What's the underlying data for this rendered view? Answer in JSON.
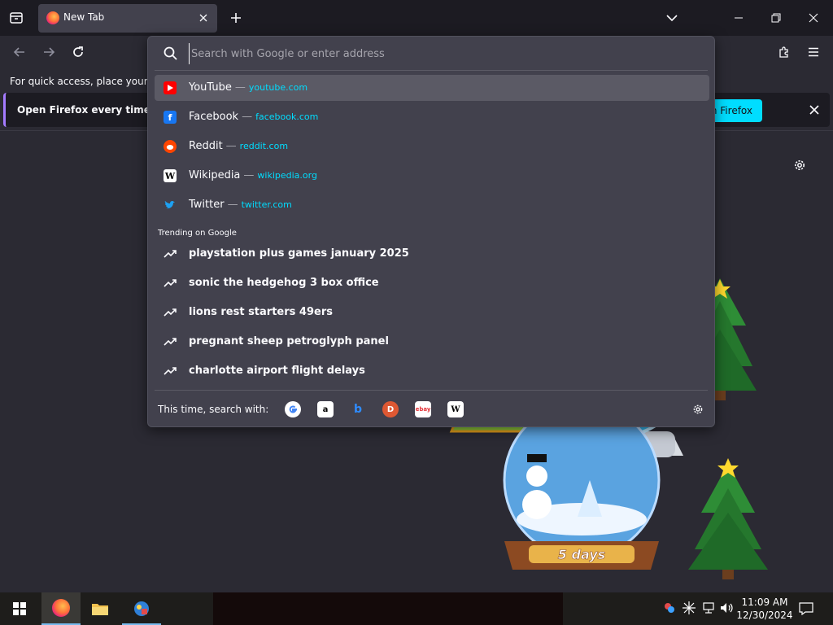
{
  "browser": {
    "tab": {
      "title": "New Tab"
    },
    "newtab_symbol": "+"
  },
  "content": {
    "bookmarks_hint": "For quick access, place your boo",
    "default_bar": {
      "message": "Open Firefox every time you",
      "cta": "n Firefox"
    }
  },
  "urlbar": {
    "placeholder": "Search with Google or enter address",
    "top_sites": [
      {
        "title": "YouTube",
        "url": "youtube.com",
        "icon": "youtube-icon",
        "color": "#ff0000"
      },
      {
        "title": "Facebook",
        "url": "facebook.com",
        "icon": "facebook-icon",
        "color": "#1877f2"
      },
      {
        "title": "Reddit",
        "url": "reddit.com",
        "icon": "reddit-icon",
        "color": "#ff4500"
      },
      {
        "title": "Wikipedia",
        "url": "wikipedia.org",
        "icon": "wikipedia-icon",
        "color": "#ffffff"
      },
      {
        "title": "Twitter",
        "url": "twitter.com",
        "icon": "twitter-icon",
        "color": "#1da1f2"
      }
    ],
    "dash": "—",
    "trending_label": "Trending on Google",
    "trending": [
      "playstation plus games january 2025",
      "sonic the hedgehog 3 box office",
      "lions rest starters 49ers",
      "pregnant sheep petroglyph panel",
      "charlotte airport flight delays"
    ],
    "search_with_label": "This time, search with:",
    "engines": [
      "google",
      "amazon",
      "bing",
      "duckduckgo",
      "ebay",
      "wikipedia"
    ]
  },
  "decorations": {
    "globe_top_label": "5 days",
    "globe_bottom_label": "5 days"
  },
  "taskbar": {
    "time": "11:09 AM",
    "date": "12/30/2024"
  },
  "colors": {
    "accent": "#00ddff",
    "selected_row": "#5b5a65",
    "panel": "#42414d",
    "toolbar": "#2b2a33",
    "tabstrip": "#1c1b22"
  }
}
